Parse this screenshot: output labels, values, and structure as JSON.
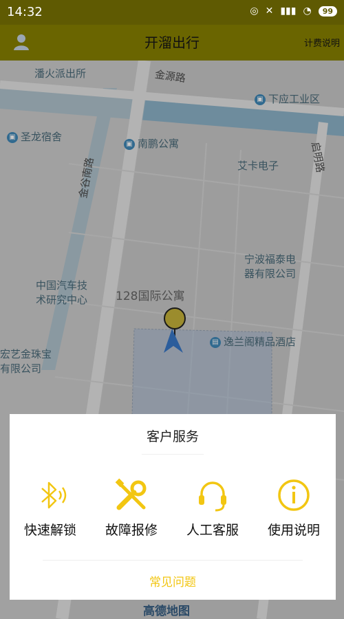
{
  "status_bar": {
    "time": "14:32",
    "battery": "99"
  },
  "header": {
    "title": "开溜出行",
    "price_link": "计费说明"
  },
  "map": {
    "roads": [
      "金源路",
      "金谷南路",
      "启明路"
    ],
    "pois": [
      {
        "name": "潘火派出所"
      },
      {
        "name": "下应工业区"
      },
      {
        "name": "圣龙宿舍"
      },
      {
        "name": "南鹏公寓"
      },
      {
        "name": "艾卡电子"
      },
      {
        "name": "宁波福泰电器有限公司",
        "line1": "宁波福泰电",
        "line2": "器有限公司"
      },
      {
        "name": "中国汽车技术研究中心",
        "line1": "中国汽车技",
        "line2": "术研究中心"
      },
      {
        "name": "128国际公寓"
      },
      {
        "name": "逸兰阁精品酒店"
      },
      {
        "name": "宏艺金珠宝有限公司",
        "line1": "宏艺金珠宝",
        "line2": "有限公司"
      }
    ],
    "watermark": "高德地图"
  },
  "modal": {
    "title": "客户服务",
    "services": [
      {
        "label": "快速解锁",
        "icon": "bluetooth-icon"
      },
      {
        "label": "故障报修",
        "icon": "wrench-screwdriver-icon"
      },
      {
        "label": "人工客服",
        "icon": "headset-icon"
      },
      {
        "label": "使用说明",
        "icon": "info-icon"
      }
    ],
    "faq_link": "常见问题"
  },
  "colors": {
    "accent": "#f2c612",
    "header_bg": "#6a6500",
    "status_bg": "#5f5a02"
  }
}
